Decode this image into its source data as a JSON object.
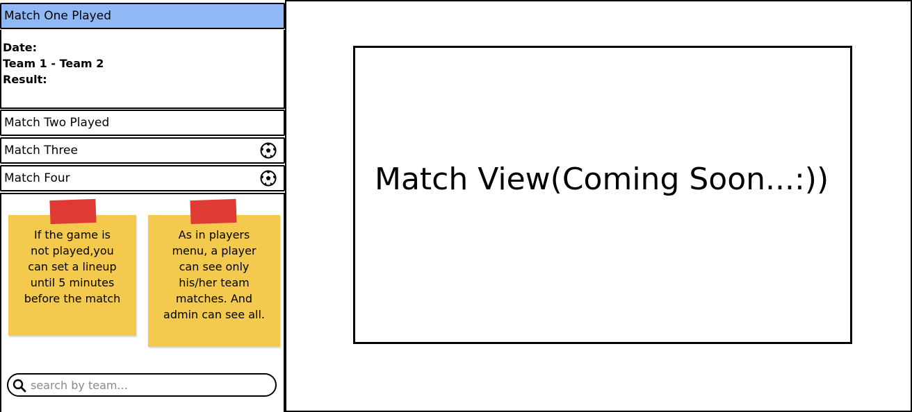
{
  "matches": [
    {
      "title": "Match One Played",
      "selected": true,
      "has_ball_icon": false
    },
    {
      "title": "Match Two Played",
      "selected": false,
      "has_ball_icon": false
    },
    {
      "title": "Match Three",
      "selected": false,
      "has_ball_icon": true
    },
    {
      "title": "Match Four",
      "selected": false,
      "has_ball_icon": true
    }
  ],
  "match_detail": {
    "date_label": "Date:",
    "teams": "Team 1 - Team 2",
    "result_label": "Result:"
  },
  "notes": [
    {
      "lines": [
        "If the game is",
        "not played,you",
        "can set a lineup",
        "until 5 minutes",
        "before the match"
      ]
    },
    {
      "lines": [
        "As in players",
        "menu, a player",
        "can see only",
        "his/her team",
        "matches. And",
        "admin can see all."
      ]
    }
  ],
  "search": {
    "placeholder": "search by team..."
  },
  "main": {
    "title": "Match View(Coming Soon...:))"
  },
  "colors": {
    "selected_header": "#8fb8f4",
    "sticky_note": "#f3c94e",
    "tape": "#e03a35"
  }
}
